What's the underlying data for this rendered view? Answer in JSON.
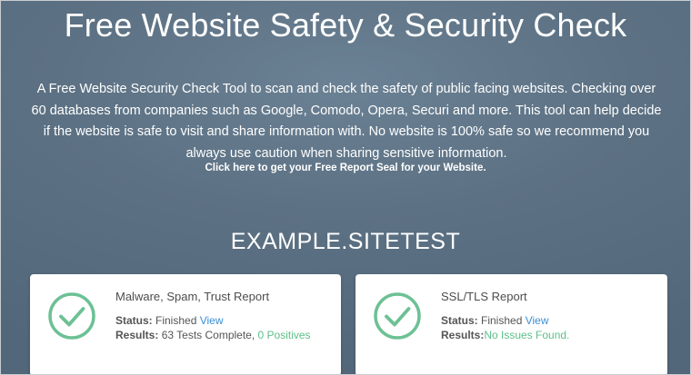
{
  "header": {
    "title": "Free Website Safety & Security Check",
    "description": "A Free Website Security Check Tool to scan and check the safety of public facing websites. Checking over 60 databases from companies such as Google, Comodo, Opera, Securi and more. This tool can help decide if the website is safe to visit and share information with. No website is 100% safe so we recommend you always use caution when sharing sensitive information.",
    "seal_link": "Click here to get your Free Report Seal for your Website."
  },
  "site": {
    "name": "EXAMPLE.SITETEST"
  },
  "reports": [
    {
      "title": "Malware, Spam, Trust Report",
      "status_label": "Status:",
      "status_value": "Finished",
      "view_link": "View",
      "results_label": "Results:",
      "results_value": "63 Tests Complete,",
      "results_highlight": "0 Positives",
      "icon": "check-circle-icon"
    },
    {
      "title": "SSL/TLS Report",
      "status_label": "Status:",
      "status_value": "Finished",
      "view_link": "View",
      "results_label": "Results:",
      "results_highlight": "No Issues Found.",
      "icon": "check-circle-icon"
    }
  ],
  "colors": {
    "background": "#5c7183",
    "check_green": "#6cc194",
    "link_blue": "#3a8fd6",
    "success_green": "#5cc08a"
  }
}
